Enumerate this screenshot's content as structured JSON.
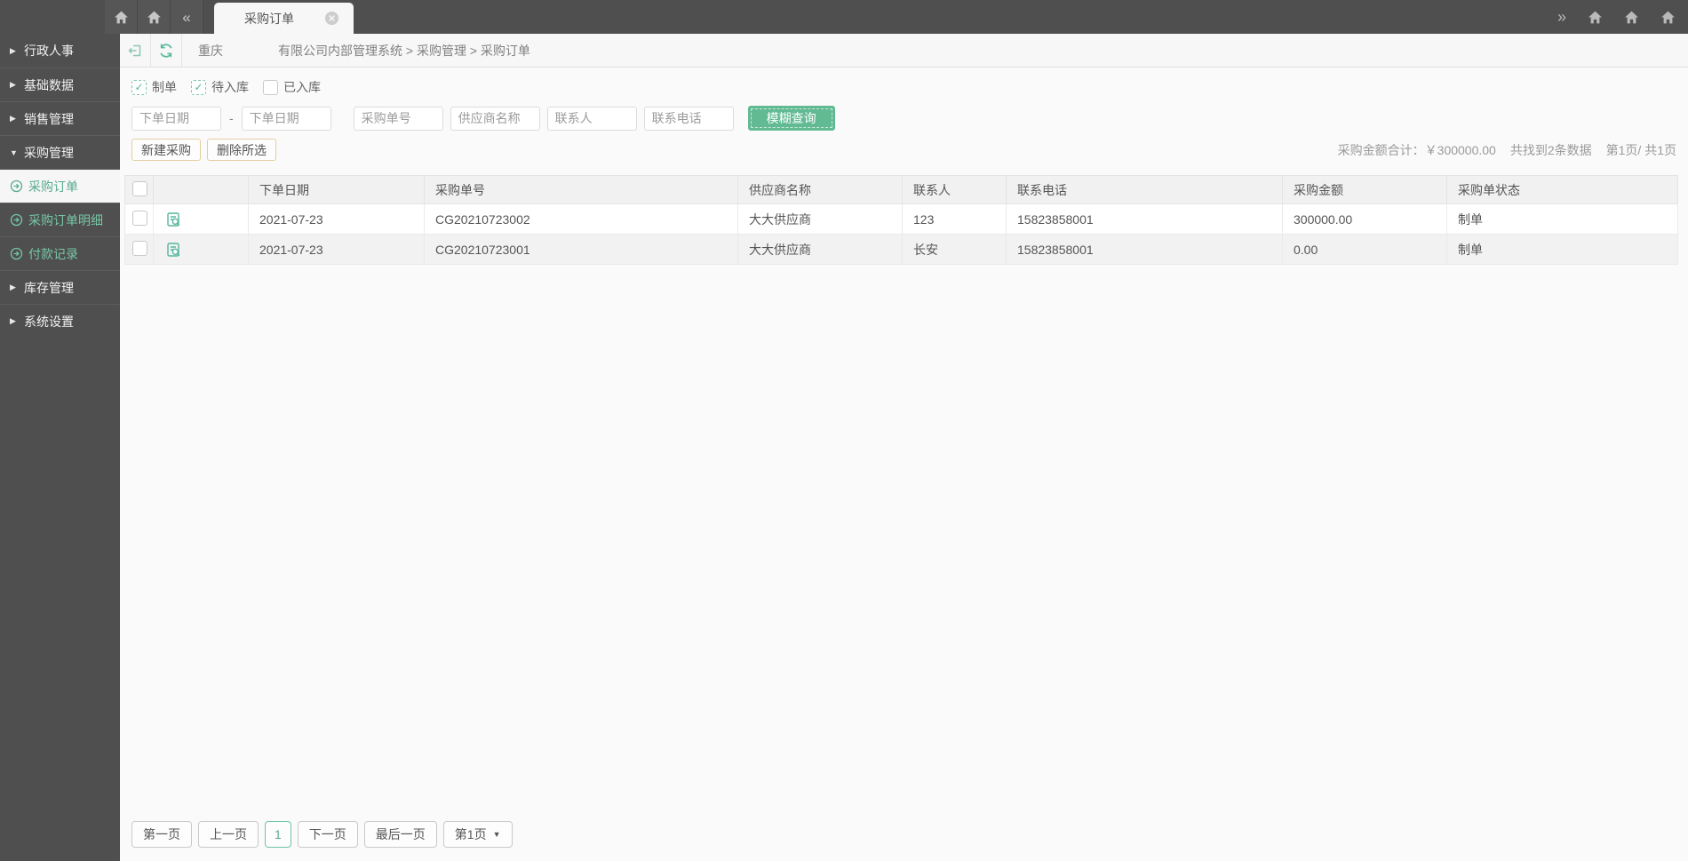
{
  "colors": {
    "topbar_dark": "#4f4f4f",
    "accent_green": "#56b79c",
    "button_green": "#62ba93",
    "sub_menu_green": "#76c7a7",
    "warm_border": "#e3cf9e"
  },
  "icons": {
    "collapsed_arrow": "▶",
    "expanded_arrow": "▼",
    "check": "✓",
    "caret_down": "▼",
    "collapse_tabs": "«",
    "expand_tabs": "»"
  },
  "tabbar": {
    "active_tab": "采购订单"
  },
  "toolbar": {
    "location": "重庆",
    "breadcrumb": "有限公司内部管理系统 > 采购管理 > 采购订单"
  },
  "sidebar": {
    "items": [
      {
        "label": "行政人事",
        "type": "group",
        "expanded": false
      },
      {
        "label": "基础数据",
        "type": "group",
        "expanded": false
      },
      {
        "label": "销售管理",
        "type": "group",
        "expanded": false
      },
      {
        "label": "采购管理",
        "type": "group",
        "expanded": true
      },
      {
        "label": "采购订单",
        "type": "sub",
        "active": true
      },
      {
        "label": "采购订单明细",
        "type": "sub",
        "active": false
      },
      {
        "label": "付款记录",
        "type": "sub",
        "active": false
      },
      {
        "label": "库存管理",
        "type": "group",
        "expanded": false
      },
      {
        "label": "系统设置",
        "type": "group",
        "expanded": false
      }
    ]
  },
  "filters": {
    "status_options": [
      {
        "label": "制单",
        "checked": true
      },
      {
        "label": "待入库",
        "checked": true
      },
      {
        "label": "已入库",
        "checked": false
      }
    ],
    "range_separator": "-",
    "inputs": {
      "date_from": "下单日期",
      "date_to": "下单日期",
      "order_no": "采购单号",
      "supplier": "供应商名称",
      "contact": "联系人",
      "phone": "联系电话"
    },
    "search_label": "模糊查询"
  },
  "actions": {
    "new_label": "新建采购",
    "delete_label": "删除所选"
  },
  "summary": {
    "total": "采购金额合计：￥300000.00",
    "result_count": "共找到2条数据",
    "page_info": "第1页/ 共1页"
  },
  "table": {
    "columns": {
      "order_date": "下单日期",
      "order_no": "采购单号",
      "supplier": "供应商名称",
      "contact": "联系人",
      "phone": "联系电话",
      "amount": "采购金额",
      "status": "采购单状态"
    },
    "rows": [
      {
        "order_date": "2021-07-23",
        "order_no": "CG20210723002",
        "supplier": "大大供应商",
        "contact": "123",
        "phone": "15823858001",
        "amount": "300000.00",
        "status": "制单"
      },
      {
        "order_date": "2021-07-23",
        "order_no": "CG20210723001",
        "supplier": "大大供应商",
        "contact": "长安",
        "phone": "15823858001",
        "amount": "0.00",
        "status": "制单"
      }
    ]
  },
  "pagination": {
    "first": "第一页",
    "prev": "上一页",
    "current": "1",
    "next": "下一页",
    "last": "最后一页",
    "page_select": "第1页"
  }
}
